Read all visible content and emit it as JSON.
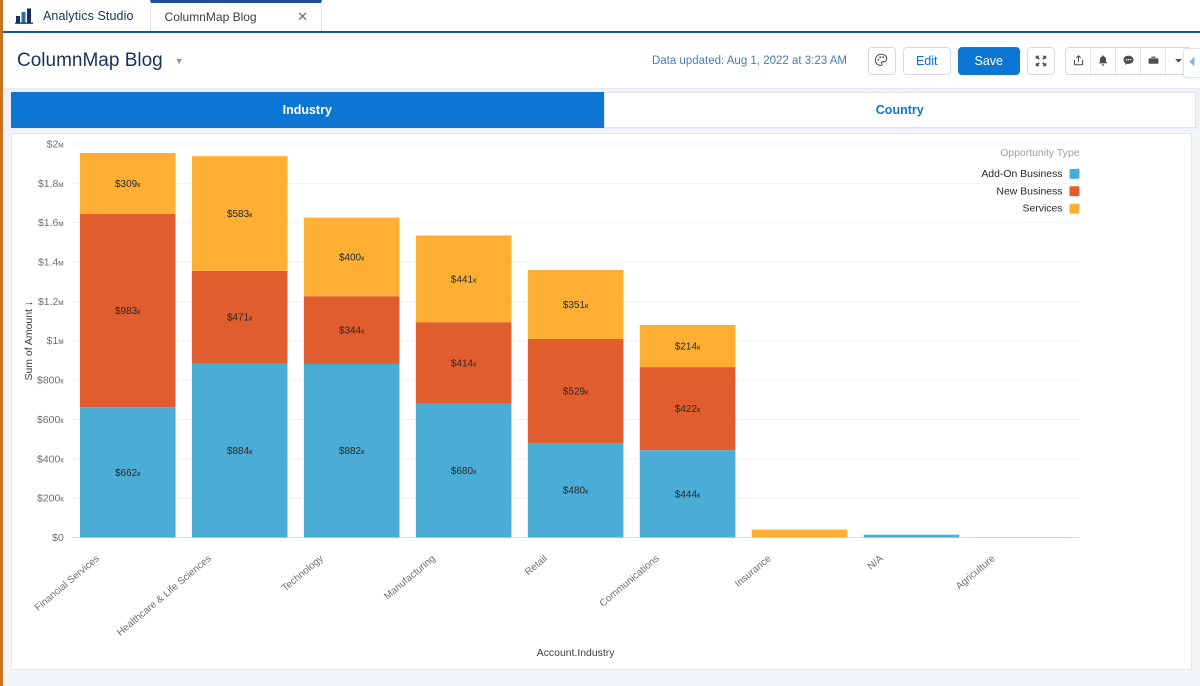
{
  "app": {
    "brand": "Analytics Studio",
    "logo_icon": "bar-chart-logo-icon"
  },
  "tab": {
    "label": "ColumnMap Blog",
    "close_icon": "close-icon"
  },
  "header": {
    "title": "ColumnMap Blog",
    "caret_icon": "chevron-down-icon",
    "data_updated": "Data updated: Aug 1, 2022 at 3:23 AM",
    "palette_icon": "palette-icon",
    "edit_label": "Edit",
    "save_label": "Save",
    "fullscreen_icon": "expand-icon",
    "group_icons": [
      {
        "name": "share-icon"
      },
      {
        "name": "bell-icon"
      },
      {
        "name": "chat-icon"
      },
      {
        "name": "briefcase-icon"
      },
      {
        "name": "chevron-down-icon"
      }
    ]
  },
  "tabs": [
    {
      "label": "Industry",
      "active": true
    },
    {
      "label": "Country",
      "active": false
    }
  ],
  "panel": {
    "collapse_icon": "chevron-left-icon"
  },
  "colors": {
    "accent": "#0d76d3",
    "brand_navy": "#16325c",
    "add_on_business": "#4bacd6",
    "new_business": "#e15d2d",
    "services": "#fdaf34",
    "orange_rail": "#c8731f"
  },
  "chart_data": {
    "type": "bar",
    "stacked": true,
    "title": "",
    "xlabel": "Account.Industry",
    "ylabel": "Sum of Amount ↓",
    "ylim": [
      0,
      2000000
    ],
    "yticks": [
      0,
      200000,
      400000,
      600000,
      800000,
      1000000,
      1200000,
      1400000,
      1600000,
      1800000,
      2000000
    ],
    "ytick_labels": [
      "$0",
      "$200к",
      "$400к",
      "$600к",
      "$800к",
      "$1м",
      "$1.2м",
      "$1.4м",
      "$1.6м",
      "$1.8м",
      "$2м"
    ],
    "grid": true,
    "legend": {
      "title": "Opportunity Type",
      "position": "right-top"
    },
    "categories": [
      "Financial Services",
      "Healthcare & Life Sciences",
      "Technology",
      "Manufacturing",
      "Retail",
      "Communications",
      "Insurance",
      "N/A",
      "Agriculture"
    ],
    "series": [
      {
        "name": "Add-On Business",
        "color": "#4bacd6",
        "values": [
          662000,
          884000,
          882000,
          680000,
          480000,
          444000,
          0,
          14000,
          0
        ],
        "labels": [
          "$662к",
          "$884к",
          "$882к",
          "$680к",
          "$480к",
          "$444к",
          "",
          "",
          ""
        ]
      },
      {
        "name": "New Business",
        "color": "#e15d2d",
        "values": [
          983000,
          471000,
          344000,
          414000,
          529000,
          422000,
          0,
          0,
          0
        ],
        "labels": [
          "$983к",
          "$471к",
          "$344к",
          "$414к",
          "$529к",
          "$422к",
          "",
          "",
          ""
        ]
      },
      {
        "name": "Services",
        "color": "#fdaf34",
        "values": [
          309000,
          583000,
          400000,
          441000,
          351000,
          214000,
          40000,
          0,
          2000
        ],
        "labels": [
          "$309к",
          "$583к",
          "$400к",
          "$441к",
          "$351к",
          "$214к",
          "",
          "",
          ""
        ]
      }
    ]
  }
}
